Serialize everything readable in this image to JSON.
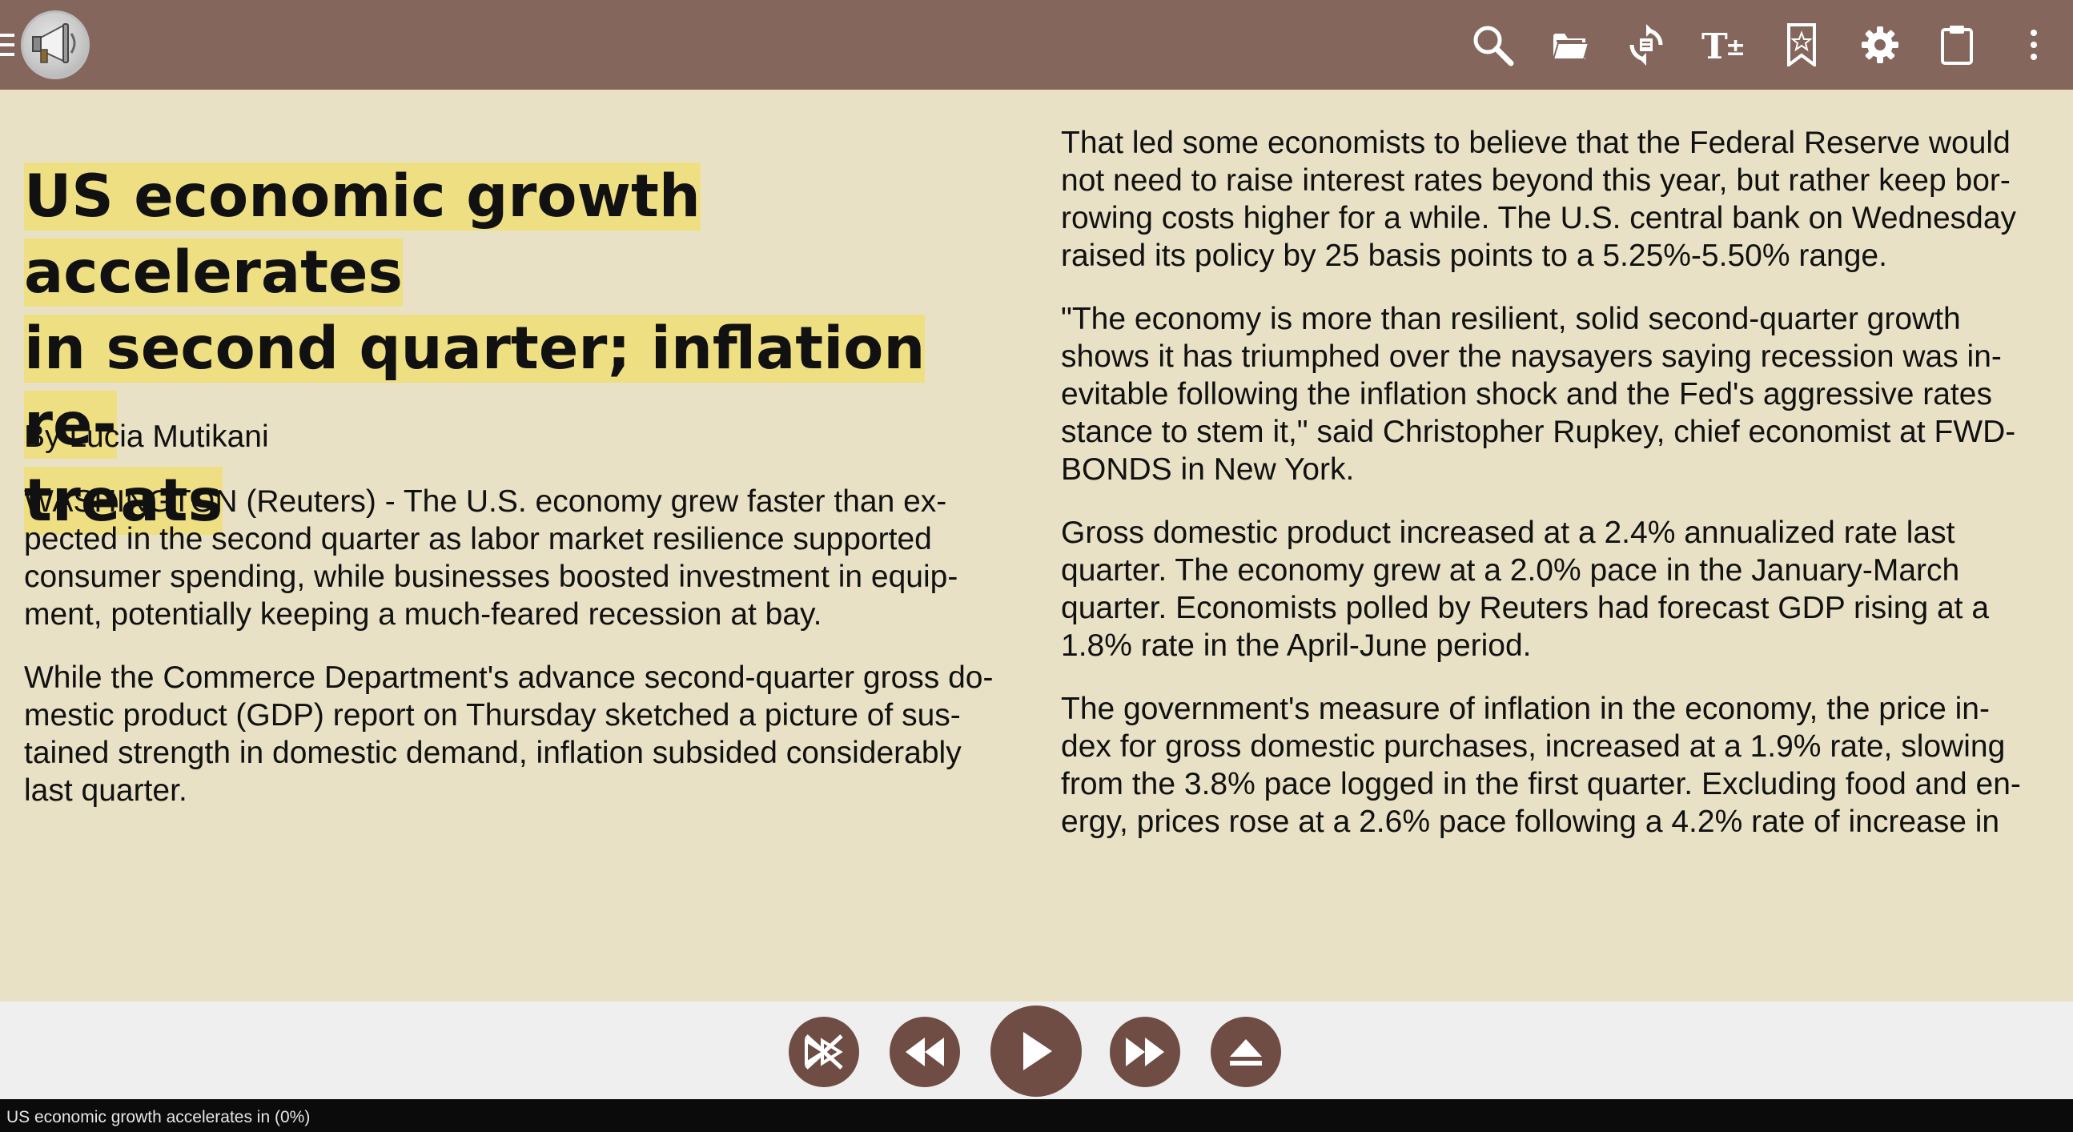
{
  "toolbar": {
    "icons": [
      "menu-icon",
      "app-logo-megaphone",
      "search-icon",
      "open-folder-icon",
      "sync-icon",
      "text-size-icon",
      "bookmark-icon",
      "settings-gear-icon",
      "clipboard-icon",
      "more-vert-icon"
    ]
  },
  "article": {
    "title_lines": [
      "US economic growth accelerates",
      "in second quarter; inflation re-",
      "treats"
    ],
    "byline": "By Lucia Mutikani",
    "left_paragraphs": [
      {
        "lines": [
          "WASHINGTON (Reuters) - The U.S. economy grew faster than ex-",
          "pected in the second quarter as labor market resilience supported",
          "consumer spending, while businesses boosted investment in equip-",
          "ment, potentially keeping a much-feared recession at bay."
        ]
      },
      {
        "lines": [
          "While the Commerce Department's advance second-quarter gross do-",
          "mestic product (GDP) report on Thursday sketched a picture of sus-",
          "tained strength in domestic demand, inflation subsided considerably",
          "last quarter."
        ]
      }
    ],
    "right_paragraphs": [
      {
        "lines": [
          "That led some economists to believe that the Federal Reserve would",
          "not need to raise interest rates beyond this year, but rather keep bor-",
          "rowing costs higher for a while. The U.S. central bank on Wednesday",
          "raised its policy by 25 basis points to a 5.25%-5.50% range."
        ]
      },
      {
        "lines": [
          "\"The economy is more than resilient, solid second-quarter growth",
          "shows it has triumphed over the naysayers saying recession was in-",
          "evitable following the inflation shock and the Fed's aggressive rates",
          "stance to stem it,\" said Christopher Rupkey, chief economist at FWD-",
          "BONDS in New York."
        ]
      },
      {
        "lines": [
          "Gross domestic product increased at a 2.4% annualized rate last",
          "quarter. The economy grew at a 2.0% pace in the January-March",
          "quarter. Economists polled by Reuters had forecast GDP rising at a",
          "1.8% rate in the April-June period."
        ]
      },
      {
        "lines": [
          "The government's measure of inflation in the economy, the price in-",
          "dex for gross domestic purchases, increased at a 1.9% rate, slowing",
          "from the 3.8% pace logged in the first quarter. Excluding food and en-",
          "ergy, prices rose at a 2.6% pace following a 4.2% rate of increase in"
        ]
      }
    ]
  },
  "player": {
    "buttons": [
      "stop-icon",
      "rewind-icon",
      "play-icon",
      "fast-forward-icon",
      "eject-icon"
    ]
  },
  "status": {
    "text": "US economic growth accelerates in (0%)"
  },
  "colors": {
    "toolbar": "#85665c",
    "page_background": "#e8e1c5",
    "title_highlight": "#efdf83",
    "player_bar": "#efefef",
    "player_button": "#6f4d45",
    "status_bar": "#0b0b0b"
  }
}
